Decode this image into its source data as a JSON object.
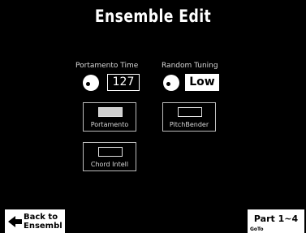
{
  "screen": {
    "title": "Ensemble Edit"
  },
  "portamento_time": {
    "label": "Portamento Time",
    "value": "127"
  },
  "random_tuning": {
    "label": "Random Tuning",
    "value": "Low"
  },
  "toggles": {
    "portamento": {
      "label": "Portamento",
      "on": true
    },
    "pitch_bender": {
      "label": "PitchBender",
      "on": false
    },
    "chord_intell": {
      "label": "Chord Intell",
      "on": false
    }
  },
  "nav": {
    "back_line1": "Back to",
    "back_line2": "Ensembl",
    "part_label": "Part 1~4",
    "part_sub": "GoTo"
  },
  "colors": {
    "background": "#000000",
    "foreground": "#ffffff"
  }
}
